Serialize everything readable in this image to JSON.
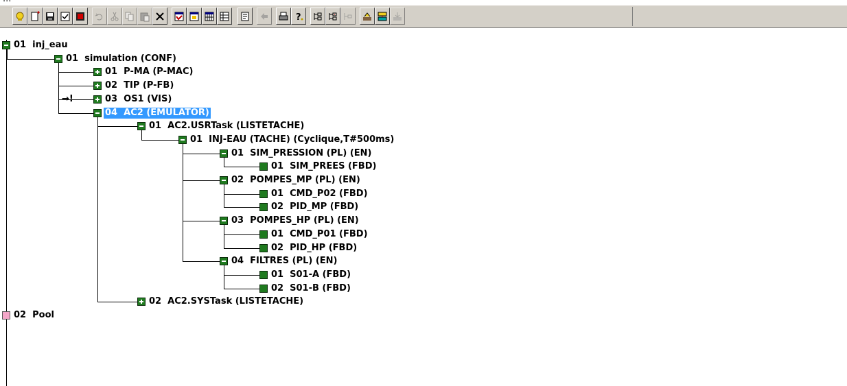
{
  "top_fragment": "...",
  "toolbar": {
    "buttons": [
      {
        "icon": "open-project-icon",
        "disabled": false
      },
      {
        "icon": "new-document-icon",
        "disabled": false
      },
      {
        "icon": "save-icon",
        "disabled": false
      },
      {
        "icon": "check-icon",
        "disabled": false
      },
      {
        "icon": "stop-icon",
        "disabled": false
      },
      {
        "icon": "undo-icon",
        "disabled": true
      },
      {
        "icon": "cut-icon",
        "disabled": true
      },
      {
        "icon": "copy-icon",
        "disabled": true
      },
      {
        "icon": "paste-icon",
        "disabled": true
      },
      {
        "icon": "delete-icon",
        "disabled": false
      },
      {
        "icon": "properties-icon",
        "disabled": false
      },
      {
        "icon": "window-icon",
        "disabled": false
      },
      {
        "icon": "grid-icon",
        "disabled": false
      },
      {
        "icon": "table-icon",
        "disabled": false
      },
      {
        "icon": "note-icon",
        "disabled": false
      },
      {
        "icon": "back-arrow-icon",
        "disabled": true
      },
      {
        "icon": "print-icon",
        "disabled": false
      },
      {
        "icon": "help-icon",
        "disabled": false
      },
      {
        "icon": "tree-expand-icon",
        "disabled": false
      },
      {
        "icon": "tree-collapse-icon",
        "disabled": false
      },
      {
        "icon": "tree-level-icon",
        "disabled": true
      },
      {
        "icon": "import-icon",
        "disabled": false
      },
      {
        "icon": "network-icon",
        "disabled": false
      },
      {
        "icon": "export-icon",
        "disabled": true
      }
    ]
  },
  "tree": {
    "nodes": [
      {
        "label": "01  inj_eau",
        "state": "expanded"
      },
      {
        "label": "01  simulation (CONF)",
        "state": "expanded"
      },
      {
        "label": "01  P-MA (P-MAC)",
        "state": "collapsed"
      },
      {
        "label": "02  TIP (P-FB)",
        "state": "collapsed"
      },
      {
        "label": "03  OS1 (VIS)",
        "state": "collapsed",
        "marker": "→!"
      },
      {
        "label": "04  AC2 (EMULATOR)",
        "state": "expanded",
        "selected": true
      },
      {
        "label": "01  AC2.USRTask (LISTETACHE)",
        "state": "expanded"
      },
      {
        "label": "01  INJ-EAU (TACHE) (Cyclique,T#500ms)",
        "state": "expanded"
      },
      {
        "label": "01  SIM_PRESSION (PL) (EN)",
        "state": "expanded"
      },
      {
        "label": "01  SIM_PREES (FBD)",
        "state": "leaf"
      },
      {
        "label": "02  POMPES_MP (PL) (EN)",
        "state": "expanded"
      },
      {
        "label": "01  CMD_P02 (FBD)",
        "state": "leaf"
      },
      {
        "label": "02  PID_MP (FBD)",
        "state": "leaf"
      },
      {
        "label": "03  POMPES_HP (PL) (EN)",
        "state": "expanded"
      },
      {
        "label": "01  CMD_P01 (FBD)",
        "state": "leaf"
      },
      {
        "label": "02  PID_HP (FBD)",
        "state": "leaf"
      },
      {
        "label": "04  FILTRES (PL) (EN)",
        "state": "expanded"
      },
      {
        "label": "01  S01-A (FBD)",
        "state": "leaf"
      },
      {
        "label": "02  S01-B (FBD)",
        "state": "leaf"
      },
      {
        "label": "02  AC2.SYSTask (LISTETACHE)",
        "state": "collapsed"
      },
      {
        "label": "02  Pool",
        "state": "leaf-pink"
      }
    ]
  },
  "colors": {
    "toolbar_bg": "#d4d0c8",
    "node_green": "#1f7a1f",
    "node_pink": "#f4a6c8",
    "selection": "#3399ff"
  }
}
